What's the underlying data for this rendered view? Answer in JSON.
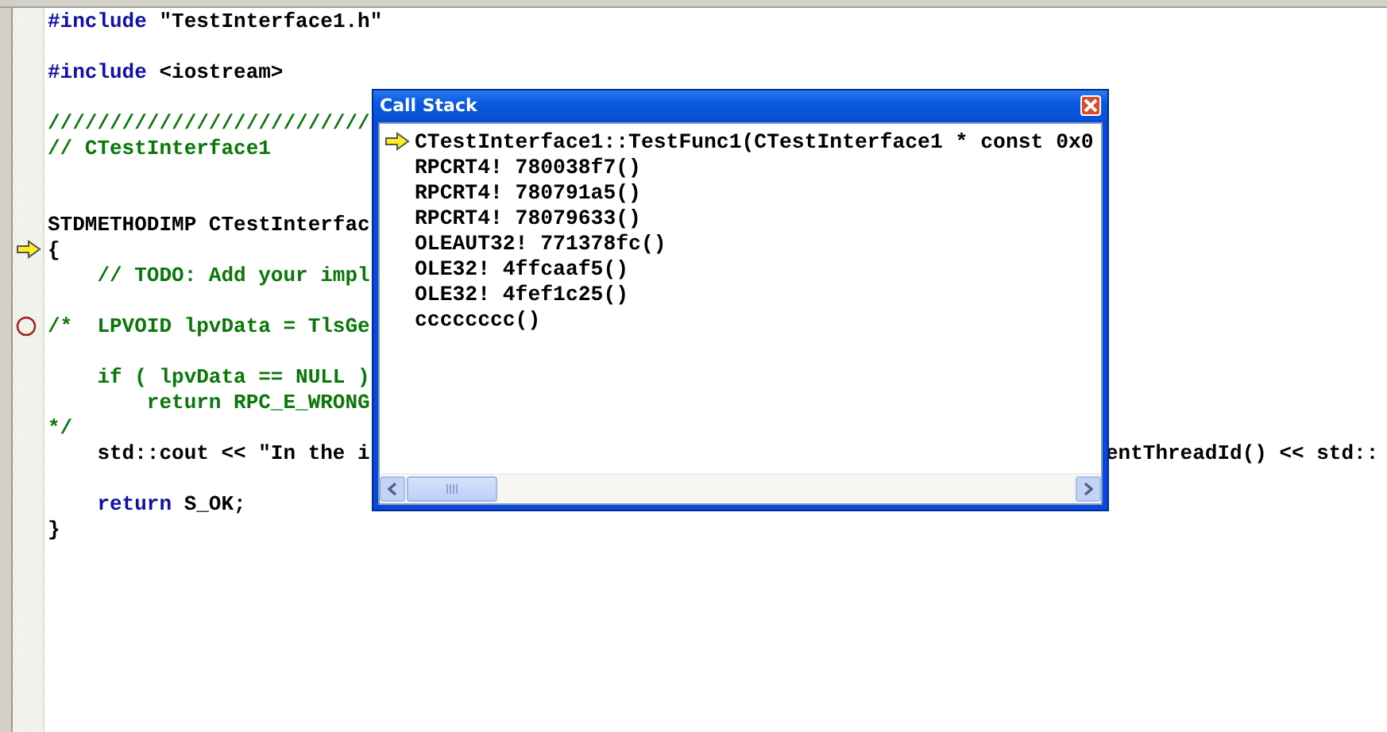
{
  "editor": {
    "lines": [
      {
        "kind": "code",
        "left": [
          {
            "text": "#include",
            "kind": "keyword"
          },
          {
            "text": " \"TestInterface1.h\"",
            "kind": "plain"
          }
        ]
      },
      {
        "kind": "blank"
      },
      {
        "kind": "code",
        "left": [
          {
            "text": "#include",
            "kind": "keyword"
          },
          {
            "text": " <iostream>",
            "kind": "plain"
          }
        ]
      },
      {
        "kind": "blank"
      },
      {
        "kind": "code",
        "left": [
          {
            "text": "//////////////////////////",
            "kind": "comment"
          }
        ]
      },
      {
        "kind": "code",
        "left": [
          {
            "text": "// CTestInterface1",
            "kind": "comment"
          }
        ]
      },
      {
        "kind": "blank"
      },
      {
        "kind": "blank"
      },
      {
        "kind": "code",
        "left": [
          {
            "text": "STDMETHODIMP CTestInterfac",
            "kind": "plain"
          }
        ]
      },
      {
        "kind": "code",
        "current": true,
        "left": [
          {
            "text": "{",
            "kind": "plain"
          }
        ]
      },
      {
        "kind": "code",
        "left": [
          {
            "text": "    // TODO: Add your impl",
            "kind": "comment"
          }
        ]
      },
      {
        "kind": "blank"
      },
      {
        "kind": "code",
        "breakpoint": true,
        "left": [
          {
            "text": "/*  LPVOID lpvData = TlsGe",
            "kind": "comment"
          }
        ]
      },
      {
        "kind": "blank"
      },
      {
        "kind": "code",
        "left": [
          {
            "text": "    if ( lpvData == NULL )",
            "kind": "comment"
          }
        ]
      },
      {
        "kind": "code",
        "left": [
          {
            "text": "        return RPC_E_WRONG",
            "kind": "comment"
          }
        ]
      },
      {
        "kind": "code",
        "left": [
          {
            "text": "*/",
            "kind": "comment"
          }
        ]
      },
      {
        "kind": "code",
        "left": [
          {
            "text": "    std::cout << \"In the i",
            "kind": "plain"
          }
        ],
        "right": [
          {
            "text": "entThreadId() << std::",
            "kind": "plain"
          }
        ]
      },
      {
        "kind": "blank"
      },
      {
        "kind": "code",
        "left": [
          {
            "text": "    return",
            "kind": "keyword"
          },
          {
            "text": " S_OK;",
            "kind": "plain"
          }
        ]
      },
      {
        "kind": "code",
        "left": [
          {
            "text": "}",
            "kind": "plain"
          }
        ]
      }
    ]
  },
  "call_stack": {
    "title": "Call Stack",
    "frames": [
      {
        "text": "CTestInterface1::TestFunc1(CTestInterface1 * const 0x0",
        "current": true
      },
      {
        "text": "RPCRT4! 780038f7()",
        "current": false
      },
      {
        "text": "RPCRT4! 780791a5()",
        "current": false
      },
      {
        "text": "RPCRT4! 78079633()",
        "current": false
      },
      {
        "text": "OLEAUT32! 771378fc()",
        "current": false
      },
      {
        "text": "OLE32! 4ffcaaf5()",
        "current": false
      },
      {
        "text": "OLE32! 4fef1c25()",
        "current": false
      },
      {
        "text": "cccccccc()",
        "current": false
      }
    ]
  }
}
